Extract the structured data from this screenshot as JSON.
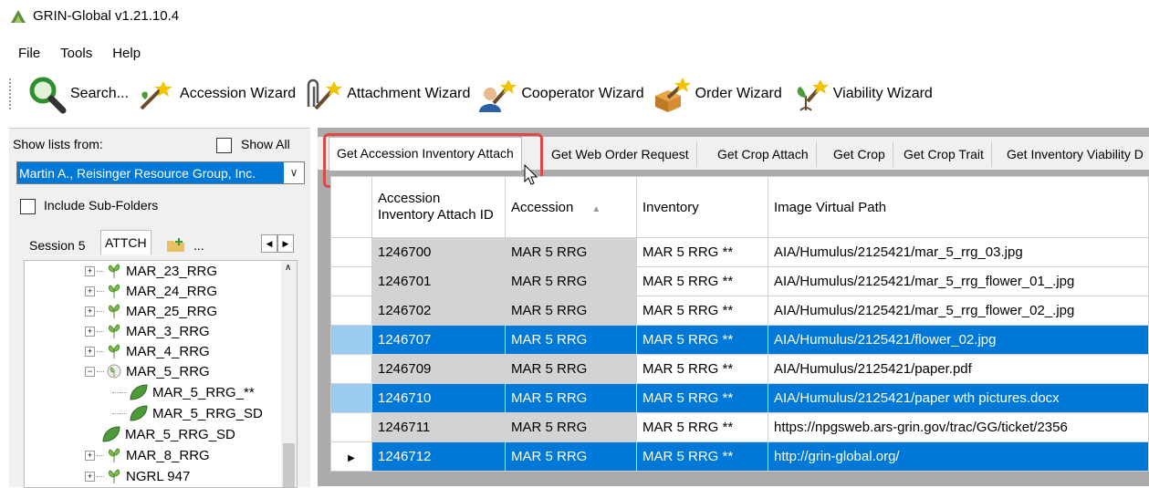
{
  "window": {
    "title": "GRIN-Global v1.21.10.4"
  },
  "menu": {
    "file": "File",
    "tools": "Tools",
    "help": "Help"
  },
  "toolbar": {
    "search": "Search...",
    "accession_wizard": "Accession Wizard",
    "attachment_wizard": "Attachment Wizard",
    "cooperator_wizard": "Cooperator Wizard",
    "order_wizard": "Order Wizard",
    "viability_wizard": "Viability Wizard"
  },
  "left": {
    "show_lists_label": "Show lists from:",
    "show_all_label": "Show All",
    "list_owner": "Martin A., Reisinger Resource Group, Inc.",
    "include_subfolders_label": "Include Sub-Folders",
    "tabs": [
      "Session 5",
      "ATTCH",
      "..."
    ],
    "tree": [
      {
        "label": "MAR_23_RRG",
        "kind": "folder"
      },
      {
        "label": "MAR_24_RRG",
        "kind": "folder"
      },
      {
        "label": "MAR_25_RRG",
        "kind": "folder"
      },
      {
        "label": "MAR_3_RRG",
        "kind": "folder"
      },
      {
        "label": "MAR_4_RRG",
        "kind": "folder"
      },
      {
        "label": "MAR_5_RRG",
        "kind": "folder-open"
      },
      {
        "label": "MAR_5_RRG_**",
        "kind": "leaf"
      },
      {
        "label": "MAR_5_RRG_SD",
        "kind": "leaf"
      },
      {
        "label": "MAR_5_RRG_SD",
        "kind": "leaf"
      },
      {
        "label": "MAR_8_RRG",
        "kind": "folder"
      },
      {
        "label": "NGRL 947",
        "kind": "folder"
      }
    ]
  },
  "right": {
    "tabs": [
      "Get Accession Inventory Attach",
      "Get Web Order Request",
      "Get Crop Attach",
      "Get Crop",
      "Get Crop Trait",
      "Get Inventory Viability D"
    ],
    "columns": [
      "Accession Inventory Attach ID",
      "Accession",
      "Inventory",
      "Image Virtual Path"
    ],
    "rows": [
      {
        "id": "1246700",
        "accession": "MAR 5 RRG",
        "inventory": "MAR 5 RRG **",
        "path": "AIA/Humulus/2125421/mar_5_rrg_03.jpg",
        "selected": false
      },
      {
        "id": "1246701",
        "accession": "MAR 5 RRG",
        "inventory": "MAR 5 RRG **",
        "path": "AIA/Humulus/2125421/mar_5_rrg_flower_01_.jpg",
        "selected": false
      },
      {
        "id": "1246702",
        "accession": "MAR 5 RRG",
        "inventory": "MAR 5 RRG **",
        "path": "AIA/Humulus/2125421/mar_5_rrg_flower_02_.jpg",
        "selected": false
      },
      {
        "id": "1246707",
        "accession": "MAR 5 RRG",
        "inventory": "MAR 5 RRG **",
        "path": "AIA/Humulus/2125421/flower_02.jpg",
        "selected": true
      },
      {
        "id": "1246709",
        "accession": "MAR 5 RRG",
        "inventory": "MAR 5 RRG **",
        "path": "AIA/Humulus/2125421/paper.pdf",
        "selected": false
      },
      {
        "id": "1246710",
        "accession": "MAR 5 RRG",
        "inventory": "MAR 5 RRG **",
        "path": "AIA/Humulus/2125421/paper wth pictures.docx",
        "selected": true
      },
      {
        "id": "1246711",
        "accession": "MAR 5 RRG",
        "inventory": "MAR 5 RRG **",
        "path": "https://npgsweb.ars-grin.gov/trac/GG/ticket/2356",
        "selected": false
      },
      {
        "id": "1246712",
        "accession": "MAR 5 RRG",
        "inventory": "MAR 5 RRG **",
        "path": "http://grin-global.org/",
        "selected": true,
        "current": true
      }
    ]
  },
  "colors": {
    "selection": "#0078d7",
    "highlight": "#e04848"
  }
}
